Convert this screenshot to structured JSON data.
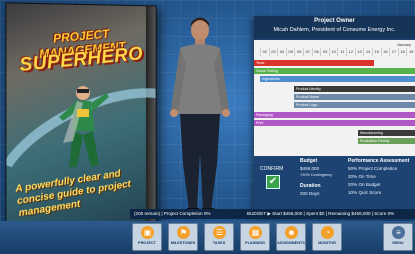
{
  "book": {
    "title_line1": "PROJECT MANAGEMENT",
    "title_line2": "SUPERHERO",
    "tagline": "A powerfully clear and concise guide to project management",
    "bottom_label": "PROJECT MANAGEMENT"
  },
  "panel": {
    "owner_title": "Project Owner",
    "owner_name": "Micah Dahlem, President of Consume Energy Inc.",
    "gantt": {
      "month": "January",
      "days": [
        "02",
        "03",
        "04",
        "05",
        "06",
        "07",
        "08",
        "09",
        "10",
        "11",
        "12",
        "13",
        "14",
        "15",
        "16",
        "17",
        "18",
        "19"
      ],
      "tasks": [
        {
          "label": "Tests",
          "color": "#d9342b"
        },
        {
          "label": "Game Testing",
          "color": "#58b24c"
        },
        {
          "label": "Ingredients",
          "color": "#4e8fcf"
        },
        {
          "label": "Product Identity",
          "color": "#3a3a3a"
        },
        {
          "label": "Product Name",
          "color": "#6d8aa8"
        },
        {
          "label": "Product Logo",
          "color": "#6d8aa8"
        },
        {
          "label": "Packaging",
          "color": "#b057c6"
        },
        {
          "label": "Print",
          "color": "#b057c6"
        },
        {
          "label": "Manufacturing",
          "color": "#3a3a3a"
        },
        {
          "label": "Production Facility",
          "color": "#6aa05a"
        }
      ]
    },
    "confirm_label": "CONFIRM",
    "budget": {
      "heading": "Budget",
      "amount": "$456,000",
      "contingency": "+20% Contingency"
    },
    "duration": {
      "heading": "Duration",
      "value": "200 Days"
    },
    "assessment": {
      "heading": "Performance Assessment",
      "lines": [
        "50% Project Completion",
        "20% On Time",
        "20% On Budget",
        "10% Quiz Score"
      ]
    }
  },
  "status": {
    "left": "(200 remain) | Project Completion 0%",
    "right": "BUDGET ▶ Start $456,000 | Spent $0 | Remaining $456,000 | Score 0%"
  },
  "toolbar": {
    "items": [
      {
        "label": "PROJECT",
        "icon": "folder-icon"
      },
      {
        "label": "MILESTONES",
        "icon": "flag-icon"
      },
      {
        "label": "TASKS",
        "icon": "checklist-icon"
      },
      {
        "label": "PLANNING",
        "icon": "calendar-icon"
      },
      {
        "label": "ASSIGNMENTS",
        "icon": "people-icon"
      },
      {
        "label": "MONITOR",
        "icon": "gauge-icon"
      },
      {
        "label": "MENU",
        "icon": "menu-icon"
      }
    ]
  }
}
